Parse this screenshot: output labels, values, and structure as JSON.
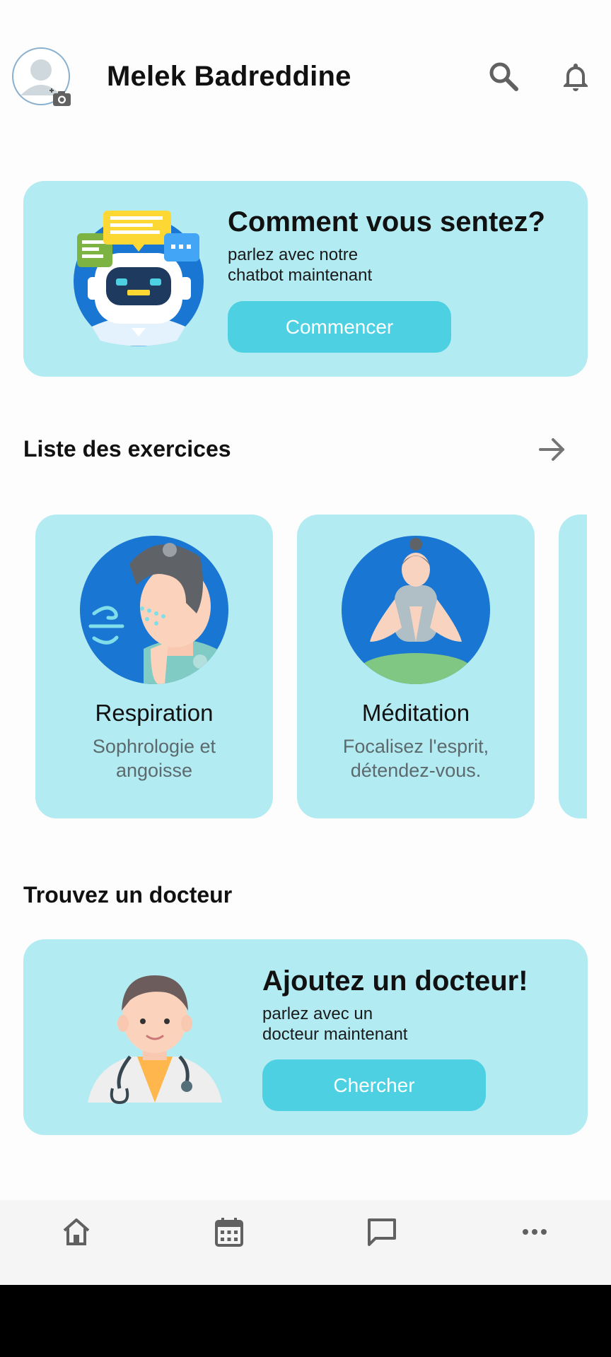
{
  "header": {
    "username": "Melek Badreddine",
    "icons": [
      "avatar-placeholder",
      "camera-icon",
      "search-icon",
      "bell-icon"
    ]
  },
  "chatbot_card": {
    "title": "Comment vous sentez?",
    "subtitle_line1": "parlez avec notre",
    "subtitle_line2": "chatbot maintenant",
    "button_label": "Commencer"
  },
  "exercises": {
    "section_title": "Liste des exercices",
    "items": [
      {
        "title": "Respiration",
        "subtitle_line1": "Sophrologie et",
        "subtitle_line2": "angoisse"
      },
      {
        "title": "Méditation",
        "subtitle_line1": "Focalisez l'esprit,",
        "subtitle_line2": "détendez-vous."
      }
    ]
  },
  "doctor": {
    "section_title": "Trouvez un docteur",
    "title": "Ajoutez un docteur!",
    "subtitle_line1": "parlez avec un",
    "subtitle_line2": "docteur maintenant",
    "button_label": "Chercher"
  },
  "bottom_nav": {
    "items": [
      "home-icon",
      "calendar-icon",
      "chat-icon",
      "more-icon"
    ]
  },
  "colors": {
    "card_bg": "#b3ebf2",
    "button_bg": "#4dd0e1",
    "robot_circle": "#1976d2"
  }
}
